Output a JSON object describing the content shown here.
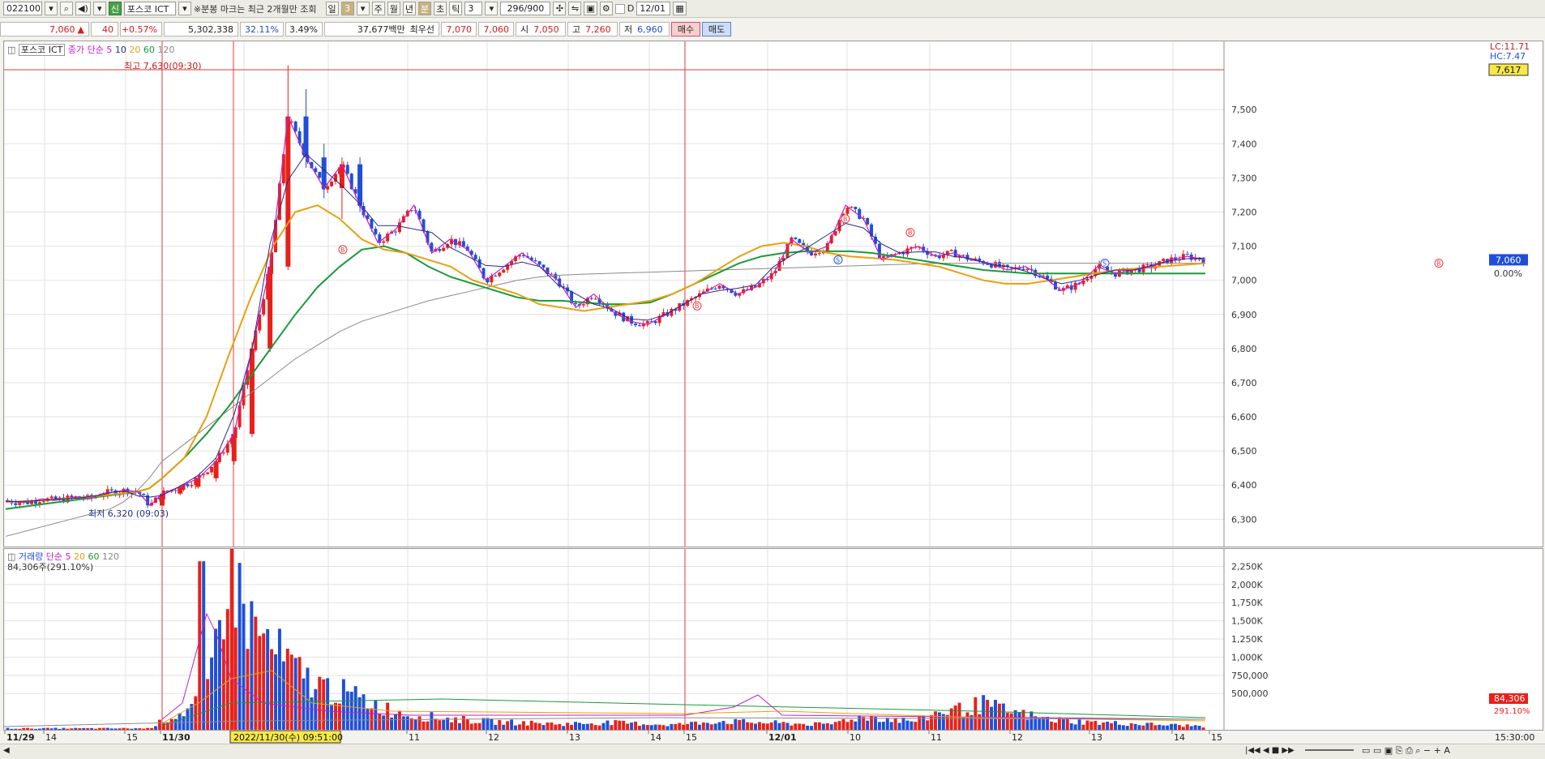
{
  "toolbar": {
    "code": "022100",
    "badge": "신",
    "stock_name": "포스코 ICT",
    "notice": "※분봉 마크는 최근 2개월만 조회",
    "period_tabs": [
      "일",
      "3",
      "주",
      "월",
      "년",
      "분",
      "초",
      "틱"
    ],
    "interval": "3",
    "count": "296/900",
    "d_label": "D",
    "date_value": "12/01"
  },
  "quote": {
    "price": "7,060",
    "change_arrow": "▲",
    "change": "40",
    "change_rate": "+0.57%",
    "volume": "5,302,338",
    "turnover_rate": "32.11%",
    "rate2": "3.49%",
    "amount": "37,677백만",
    "best_label": "최우선",
    "best_ask": "7,070",
    "best_bid": "7,060",
    "open_label": "시",
    "open": "7,050",
    "high_label": "고",
    "high": "7,260",
    "low_label": "저",
    "low": "6,960",
    "buy_label": "매수",
    "sell_label": "매도"
  },
  "price_legend": {
    "name": "포스코 ICT",
    "ma_title": "종가 단순",
    "periods": [
      "5",
      "10",
      "20",
      "60",
      "120"
    ]
  },
  "volume_legend": {
    "name": "거래량",
    "ma_title": "단순",
    "periods": [
      "5",
      "20",
      "60",
      "120"
    ],
    "current": "84,306주(291.10%)"
  },
  "annotations": {
    "high": "최고 7,630(09:30)",
    "low": "최저 6,320 (09:03)",
    "lc": "LC:11.71",
    "hc": "HC:7.47",
    "cursor_price": "7,617",
    "last_price": "7,060",
    "zero_pct": "0.00%",
    "vol_last": "84,306",
    "vol_pct": "291.10%",
    "cursor_time": "2022/11/30(수) 09:51:00",
    "end_time": "15:30:00"
  },
  "colors": {
    "up": "#e8201a",
    "down": "#1f4fd8",
    "ma5": "#c81cc8",
    "ma10": "#2a2a8a",
    "ma20": "#e8a010",
    "ma60": "#1a9a3a",
    "ma120": "#8a8a8a"
  },
  "chart_data": {
    "type": "candlestick",
    "price_axis": {
      "ticks": [
        "7,500",
        "7,400",
        "7,300",
        "7,200",
        "7,100",
        "7,000",
        "6,900",
        "6,800",
        "6,700",
        "6,600",
        "6,500",
        "6,400",
        "6,300"
      ],
      "range": [
        6220,
        7700
      ]
    },
    "volume_axis": {
      "ticks": [
        "2,250K",
        "2,000K",
        "1,750K",
        "1,500K",
        "1,250K",
        "1,000K",
        "750,000",
        "500,000"
      ],
      "range": [
        0,
        2400000
      ]
    },
    "x_labels": [
      "11/29",
      "14",
      "15",
      "11/30",
      "10",
      "11",
      "12",
      "13",
      "14",
      "15",
      "12/01",
      "10",
      "11",
      "12",
      "13",
      "14",
      "15"
    ],
    "bold_x_labels": [
      "11/29",
      "11/30",
      "12/01"
    ],
    "ohlc_anchors": [
      [
        6350,
        6360,
        6340,
        6355
      ],
      [
        6355,
        6365,
        6345,
        6350
      ],
      [
        6350,
        6360,
        6345,
        6350
      ],
      [
        6350,
        6370,
        6345,
        6360
      ],
      [
        6360,
        6370,
        6350,
        6355
      ],
      [
        6355,
        6365,
        6350,
        6360
      ],
      [
        6360,
        6375,
        6355,
        6365
      ],
      [
        6365,
        6375,
        6355,
        6360
      ],
      [
        6360,
        6380,
        6355,
        6375
      ],
      [
        6375,
        6390,
        6365,
        6380
      ],
      [
        6380,
        6390,
        6370,
        6385
      ],
      [
        6385,
        6395,
        6375,
        6380
      ],
      [
        6380,
        6390,
        6330,
        6340
      ],
      [
        6340,
        6380,
        6320,
        6375
      ],
      [
        6375,
        6400,
        6370,
        6395
      ],
      [
        6395,
        6430,
        6390,
        6420
      ],
      [
        6420,
        6480,
        6410,
        6470
      ],
      [
        6470,
        6560,
        6460,
        6550
      ],
      [
        6550,
        6820,
        6540,
        6800
      ],
      [
        6800,
        7060,
        6790,
        7040
      ],
      [
        7040,
        7630,
        7030,
        7480
      ],
      [
        7480,
        7560,
        7330,
        7360
      ],
      [
        7360,
        7400,
        7240,
        7270
      ],
      [
        7270,
        7360,
        7180,
        7340
      ],
      [
        7340,
        7360,
        7200,
        7220
      ],
      [
        7220,
        7280,
        7080,
        7110
      ],
      [
        7110,
        7180,
        7080,
        7150
      ],
      [
        7150,
        7240,
        7100,
        7220
      ],
      [
        7220,
        7240,
        7060,
        7080
      ],
      [
        7080,
        7150,
        7060,
        7120
      ],
      [
        7120,
        7140,
        7060,
        7090
      ],
      [
        7090,
        7120,
        6980,
        7000
      ],
      [
        7000,
        7060,
        6960,
        7040
      ],
      [
        7040,
        7090,
        7020,
        7080
      ],
      [
        7080,
        7090,
        7030,
        7040
      ],
      [
        7040,
        7060,
        6990,
        7000
      ],
      [
        7000,
        7010,
        6900,
        6920
      ],
      [
        6920,
        6980,
        6880,
        6960
      ],
      [
        6960,
        6980,
        6900,
        6910
      ],
      [
        6910,
        6940,
        6860,
        6880
      ],
      [
        6880,
        6920,
        6840,
        6870
      ],
      [
        6870,
        6910,
        6860,
        6900
      ],
      [
        6900,
        6950,
        6880,
        6930
      ],
      [
        6930,
        6980,
        6910,
        6960
      ],
      [
        6960,
        7010,
        6940,
        6990
      ],
      [
        6990,
        7000,
        6940,
        6960
      ],
      [
        6960,
        6990,
        6930,
        6980
      ],
      [
        6980,
        7040,
        6960,
        7020
      ],
      [
        7020,
        7170,
        7000,
        7120
      ],
      [
        7120,
        7160,
        7060,
        7080
      ],
      [
        7080,
        7120,
        7040,
        7100
      ],
      [
        7100,
        7240,
        7080,
        7220
      ],
      [
        7220,
        7260,
        7160,
        7180
      ],
      [
        7180,
        7200,
        7050,
        7060
      ],
      [
        7060,
        7100,
        7040,
        7080
      ],
      [
        7080,
        7110,
        7060,
        7100
      ],
      [
        7100,
        7120,
        7050,
        7070
      ],
      [
        7070,
        7100,
        7050,
        7080
      ],
      [
        7080,
        7090,
        7040,
        7060
      ],
      [
        7060,
        7080,
        7030,
        7050
      ],
      [
        7050,
        7060,
        7010,
        7030
      ],
      [
        7030,
        7050,
        7000,
        7040
      ],
      [
        7040,
        7050,
        6990,
        7010
      ],
      [
        7010,
        7020,
        6960,
        6970
      ],
      [
        6970,
        7000,
        6960,
        6990
      ],
      [
        6990,
        7050,
        6980,
        7040
      ],
      [
        7040,
        7050,
        7010,
        7020
      ],
      [
        7020,
        7040,
        7000,
        7030
      ],
      [
        7030,
        7050,
        7010,
        7040
      ],
      [
        7040,
        7070,
        7030,
        7060
      ],
      [
        7060,
        7080,
        7040,
        7070
      ],
      [
        7070,
        7090,
        7050,
        7060
      ]
    ],
    "ma": {
      "ma20": [
        6350,
        6352,
        6354,
        6356,
        6358,
        6362,
        6365,
        6368,
        6372,
        6376,
        6380,
        6390,
        6420,
        6480,
        6600,
        6780,
        6950,
        7100,
        7200,
        7220,
        7180,
        7120,
        7090,
        7080,
        7060,
        7040,
        7000,
        6980,
        6960,
        6930,
        6920,
        6910,
        6920,
        6930,
        6940,
        6960,
        6990,
        7030,
        7070,
        7100,
        7110,
        7100,
        7080,
        7070,
        7065,
        7060,
        7050,
        7040,
        7020,
        7000,
        6990,
        6990,
        7000,
        7010,
        7020,
        7030,
        7035,
        7040,
        7045,
        7050
      ],
      "ma60": [
        6330,
        6335,
        6340,
        6345,
        6350,
        6355,
        6360,
        6365,
        6370,
        6375,
        6380,
        6390,
        6420,
        6480,
        6550,
        6630,
        6720,
        6810,
        6900,
        6980,
        7040,
        7090,
        7100,
        7080,
        7040,
        7010,
        6990,
        6970,
        6950,
        6940,
        6940,
        6935,
        6930,
        6930,
        6935,
        6960,
        6990,
        7020,
        7050,
        7070,
        7080,
        7085,
        7085,
        7085,
        7080,
        7070,
        7060,
        7050,
        7040,
        7030,
        7025,
        7020,
        7020,
        7020,
        7020,
        7020,
        7020,
        7020,
        7020,
        7020
      ],
      "ma120": [
        6250,
        6260,
        6270,
        6280,
        6290,
        6300,
        6310,
        6320,
        6330,
        6350,
        6380,
        6420,
        6470,
        6520,
        6570,
        6620,
        6670,
        6720,
        6770,
        6810,
        6850,
        6880,
        6900,
        6920,
        6940,
        6955,
        6970,
        6985,
        7000,
        7010,
        7015,
        7018,
        7020,
        7022,
        7024,
        7026,
        7028,
        7030,
        7032,
        7034,
        7036,
        7038,
        7040,
        7042,
        7044,
        7046,
        7048,
        7050,
        7050,
        7050,
        7050,
        7050,
        7050,
        7050,
        7050,
        7050,
        7050,
        7050,
        7050,
        7050
      ]
    },
    "volume_anchors": [
      20000,
      20000,
      20000,
      20000,
      20000,
      20000,
      20000,
      20000,
      20000,
      20000,
      20000,
      20000,
      120000,
      250000,
      420000,
      2320000,
      1450000,
      1100000,
      800000,
      620000,
      520000,
      420000,
      300000,
      220000,
      180000,
      150000,
      130000,
      110000,
      100000,
      90000,
      80000,
      90000,
      100000,
      90000,
      80000,
      70000,
      90000,
      120000,
      110000,
      100000,
      90000,
      80000,
      70000,
      160000,
      180000,
      140000,
      120000,
      250000,
      280000,
      350000,
      260000,
      200000,
      140000,
      120000,
      100000,
      90000,
      80000,
      70000,
      60000,
      50000
    ]
  }
}
